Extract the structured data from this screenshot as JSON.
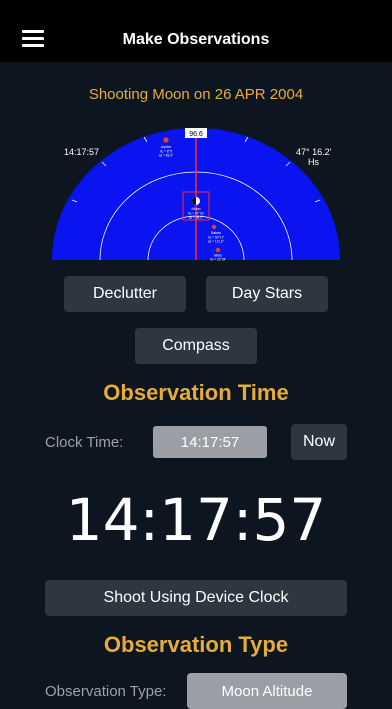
{
  "header": {
    "title": "Make Observations",
    "menu_icon": "hamburger-menu-icon"
  },
  "subtitle": "Shooting Moon on 26 APR 2004",
  "sky_view": {
    "azimuth_readout": "96.6",
    "time_readout": "14:17:57",
    "hs_value": "47° 16.2'",
    "hs_label": "Hs",
    "colors": {
      "sky": "#0a14f0",
      "ring": "#ffffff",
      "meridian": "#ff2b2b",
      "planet": "#e8451c"
    },
    "bodies": [
      {
        "name": "Jupiter",
        "line1": "hc = 8°0'",
        "line2": "az = 63.0°"
      },
      {
        "name": "Moon",
        "line1": "hc = 47°32'",
        "line2": "az = 96.5°"
      },
      {
        "name": "Saturn",
        "line1": "hc = 50°17'",
        "line2": "az = 121.6°"
      },
      {
        "name": "Mars",
        "line1": "hc = 22°34'",
        "line2": ""
      }
    ]
  },
  "buttons": {
    "declutter": "Declutter",
    "day_stars": "Day Stars",
    "compass": "Compass"
  },
  "observation_time": {
    "title": "Observation Time",
    "clock_label": "Clock Time:",
    "clock_value": "14:17:57",
    "now_label": "Now",
    "big_clock": "14:17:57",
    "shoot_button": "Shoot Using Device Clock"
  },
  "observation_type": {
    "title": "Observation Type",
    "label": "Observation Type:",
    "value": "Moon Altitude"
  }
}
